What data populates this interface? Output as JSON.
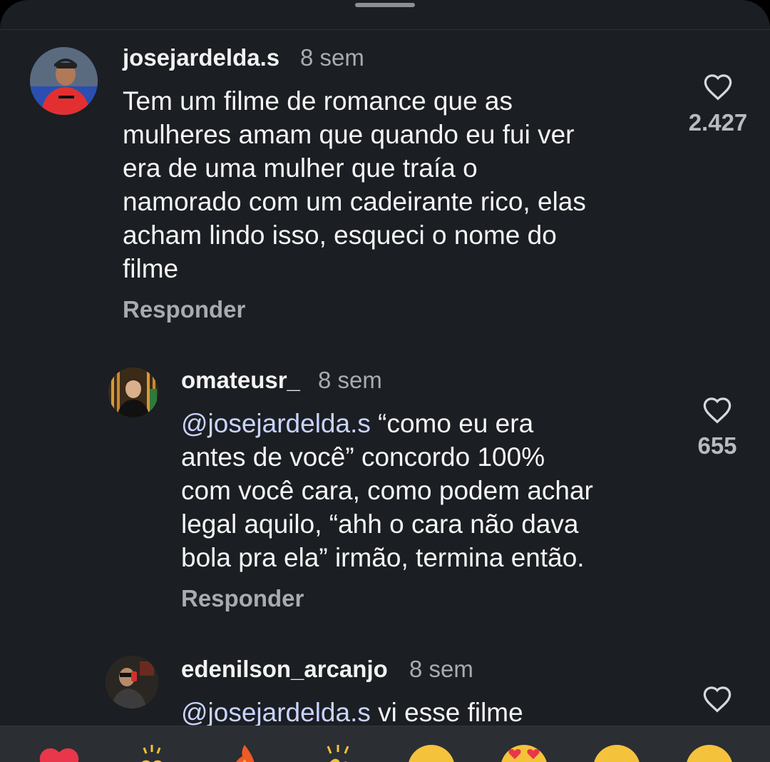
{
  "comments": [
    {
      "username": "josejardelda.s",
      "time": "8 sem",
      "text_lines": [
        "Tem um filme de romance que as",
        "mulheres amam que quando eu fui ver",
        "era de uma mulher que traía o",
        "namorado com um cadeirante rico, elas",
        "acham lindo isso, esqueci o nome do",
        "filme"
      ],
      "reply_label": "Responder",
      "likes": "2.427"
    },
    {
      "username": "omateusr_",
      "time": "8 sem",
      "mention": "@josejardelda.s",
      "text_first_rest": " “como eu era",
      "text_lines": [
        "antes de você” concordo 100%",
        "com você cara, como podem achar",
        "legal aquilo, “ahh o cara não dava",
        "bola pra ela” irmão, termina então."
      ],
      "reply_label": "Responder",
      "likes": "655"
    },
    {
      "username": "edenilson_arcanjo",
      "time": "8 sem",
      "mention": "@josejardelda.s",
      "text_first_rest": " vi esse filme"
    }
  ],
  "emoji_bar": [
    "red-heart",
    "raising-hands",
    "fire",
    "clapping-hands",
    "smiling-face",
    "heart-eyes-face",
    "grinning-face",
    "laughing-face"
  ],
  "colors": {
    "background": "#1b1e22",
    "mention": "#c9d4ff",
    "muted": "#a8abb0",
    "text": "#f5f5f5"
  }
}
